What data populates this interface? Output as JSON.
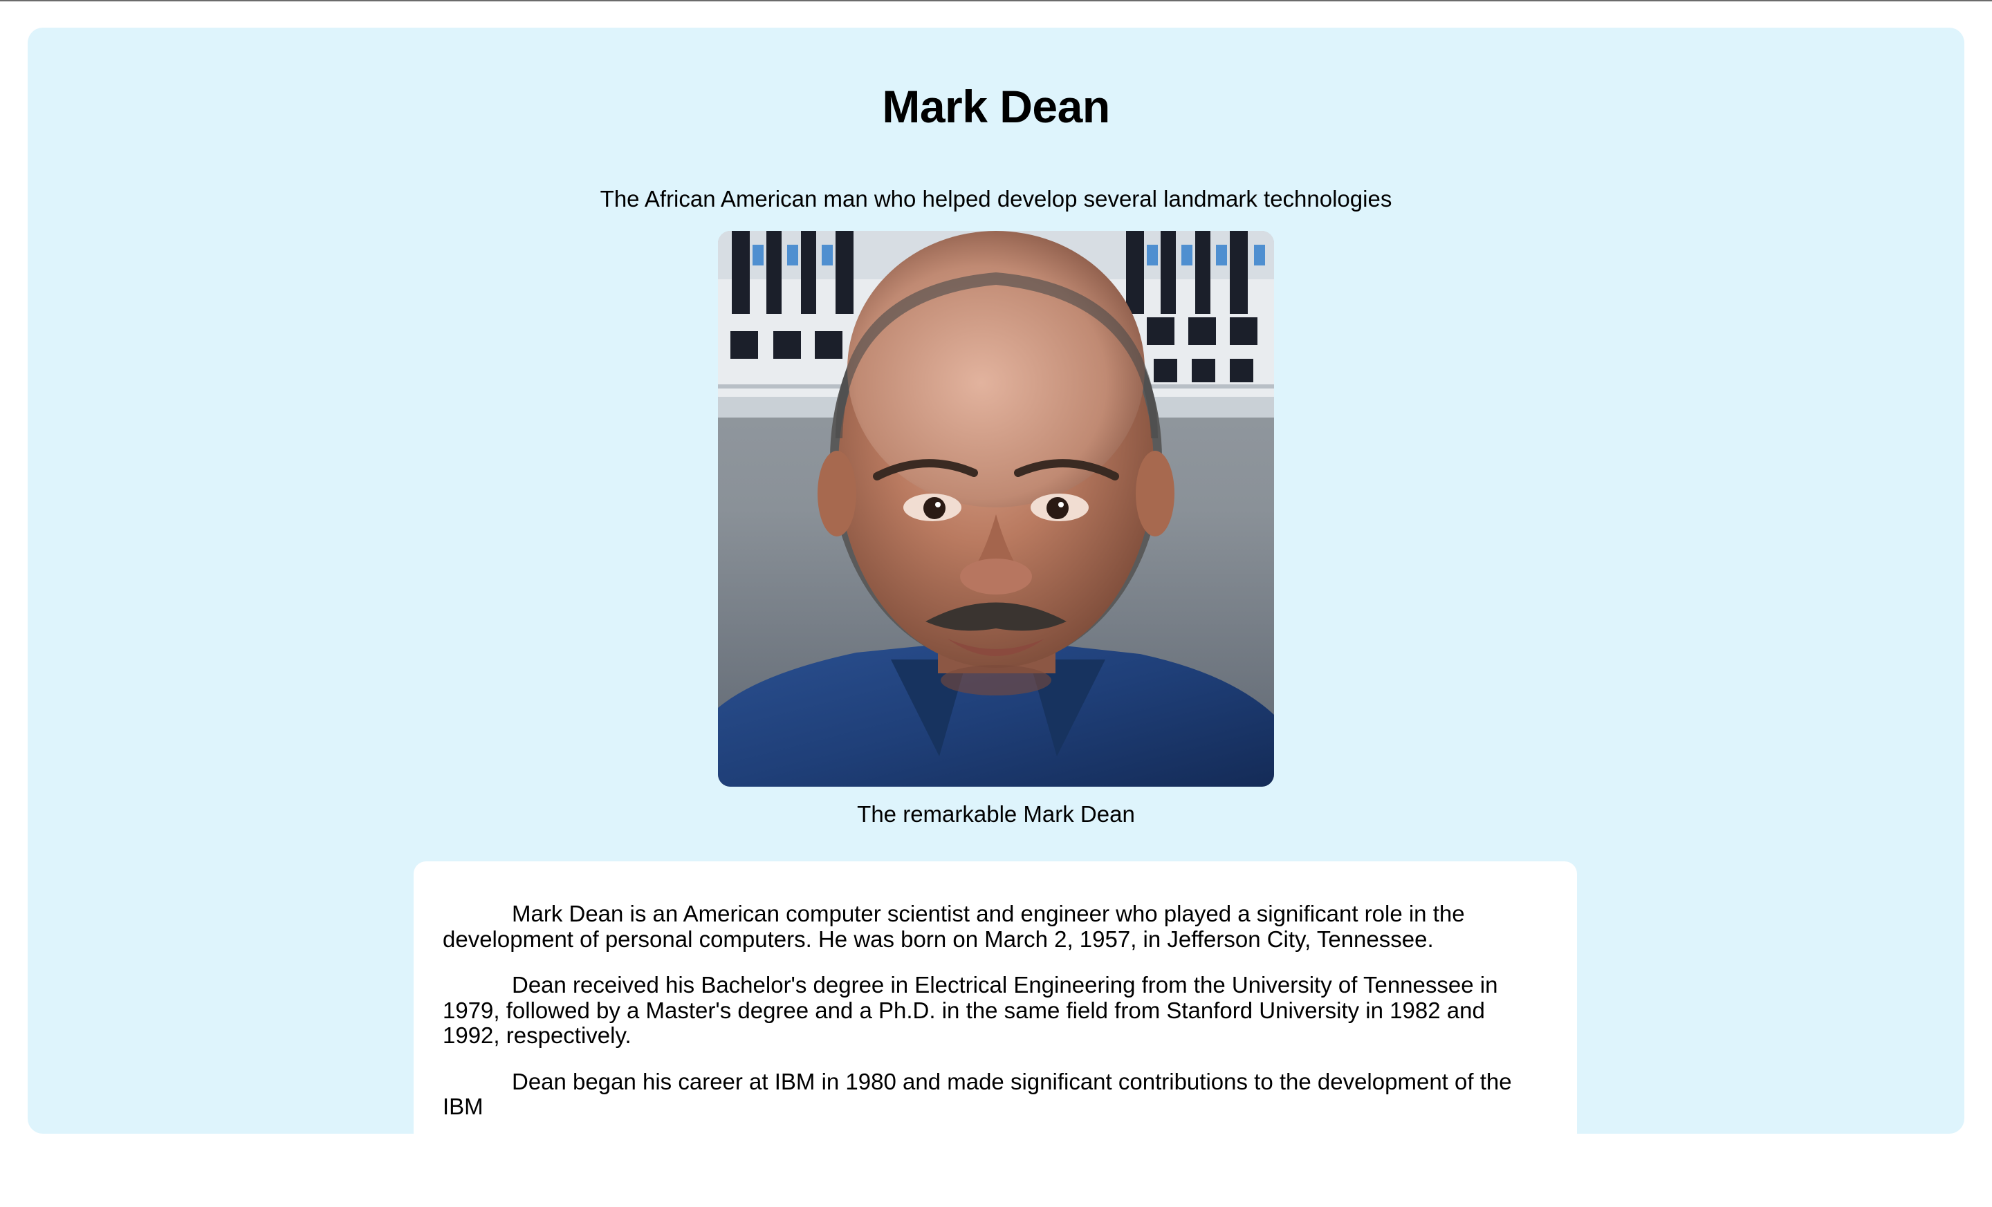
{
  "page": {
    "title": "Mark Dean",
    "subtitle": "The African American man who helped develop several landmark technologies"
  },
  "figure": {
    "caption": "The remarkable Mark Dean"
  },
  "article": {
    "paragraphs": [
      "Mark Dean is an American computer scientist and engineer who played a significant role in the development of personal computers. He was born on March 2, 1957, in Jefferson City, Tennessee.",
      "Dean received his Bachelor's degree in Electrical Engineering from the University of Tennessee in 1979, followed by a Master's degree and a Ph.D. in the same field from Stanford University in 1982 and 1992, respectively.",
      "Dean began his career at IBM in 1980 and made significant contributions to the development of the IBM"
    ]
  },
  "colors": {
    "page_background": "#def4fc",
    "card_background": "#ffffff",
    "top_border": "#6b6b6b"
  }
}
